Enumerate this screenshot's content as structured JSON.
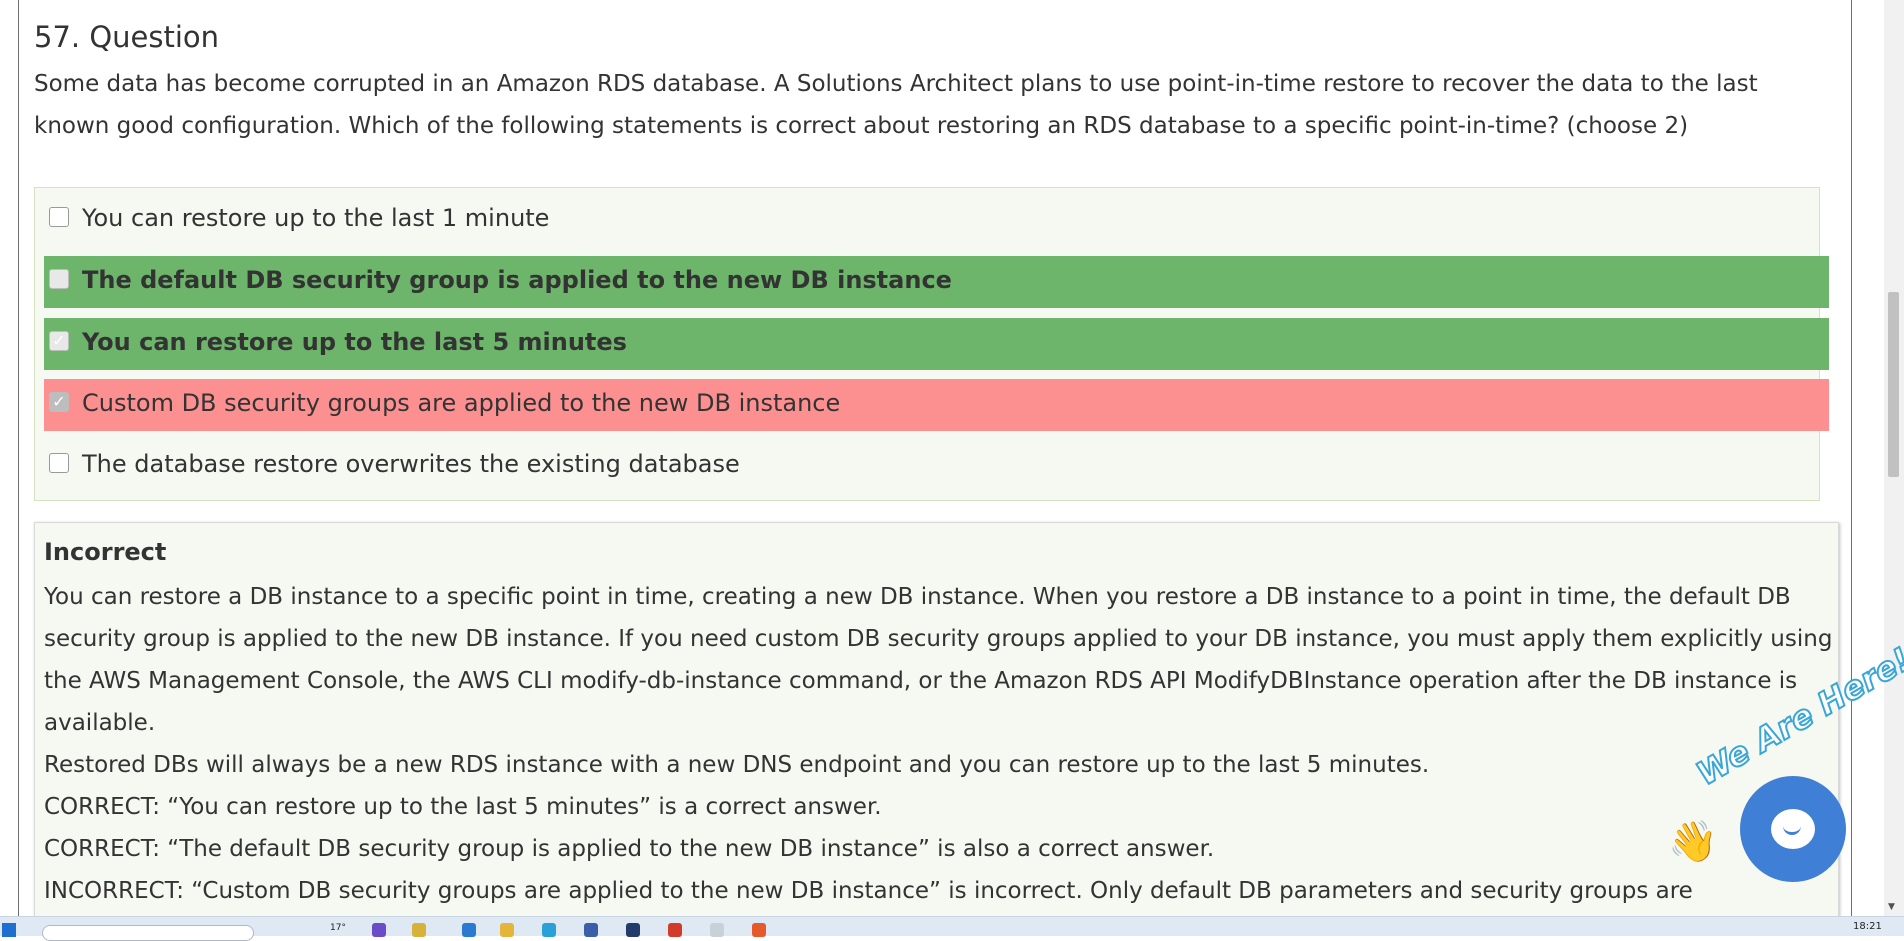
{
  "question": {
    "title": "57. Question",
    "text": "Some data has become corrupted in an Amazon RDS database. A Solutions Architect plans to use point-in-time restore to recover the data to the last known good configuration. Which of the following statements is correct about restoring an RDS database to a specific point-in-time? (choose 2)"
  },
  "answers": [
    {
      "label": "You can restore up to the last 1 minute",
      "checked": false,
      "state": "neutral"
    },
    {
      "label": "The default DB security group is applied to the new DB instance",
      "checked": false,
      "state": "correct"
    },
    {
      "label": "You can restore up to the last 5 minutes",
      "checked": true,
      "state": "correct"
    },
    {
      "label": "Custom DB security groups are applied to the new DB instance",
      "checked": true,
      "state": "wrong"
    },
    {
      "label": "The database restore overwrites the existing database",
      "checked": false,
      "state": "neutral"
    }
  ],
  "explanation": {
    "heading": "Incorrect",
    "paragraphs": [
      "You can restore a DB instance to a specific point in time, creating a new DB instance. When you restore a DB instance to a point in time, the default DB security group is applied to the new DB instance. If you need custom DB security groups applied to your DB instance, you must apply them explicitly using the AWS Management Console, the AWS CLI modify-db-instance command, or the Amazon RDS API ModifyDBInstance operation after the DB instance is available.",
      "Restored DBs will always be a new RDS instance with a new DNS endpoint and you can restore up to the last 5 minutes.",
      "CORRECT: “You can restore up to the last 5 minutes” is a correct answer.",
      "CORRECT: “The default DB security group is applied to the new DB instance” is also a correct answer.",
      "INCORRECT: “Custom DB security groups are applied to the new DB instance” is incorrect. Only default DB parameters and security groups are"
    ]
  },
  "chat_widget": {
    "banner_text": "We Are Here!",
    "color": "#3f7fd6"
  },
  "taskbar": {
    "temperature": "17°",
    "clock": "18:21"
  },
  "colors": {
    "correct": "#6db56a",
    "wrong": "#fc9090",
    "panel": "#f6f8f2"
  }
}
